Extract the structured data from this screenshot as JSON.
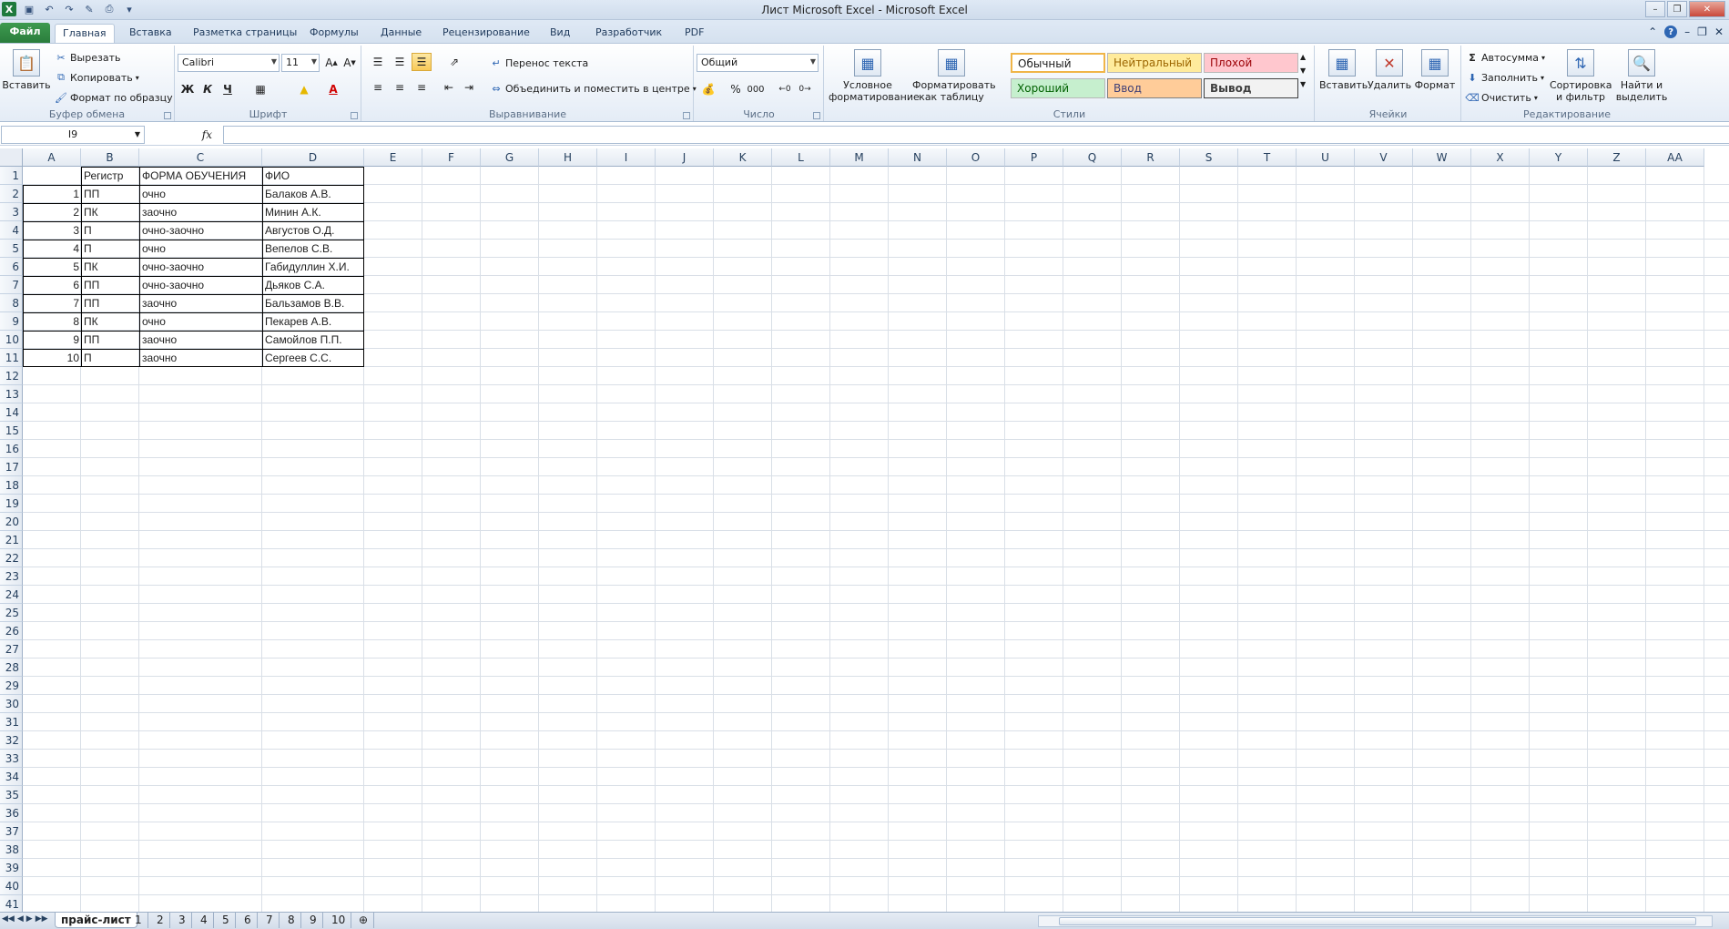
{
  "window": {
    "title": "Лист Microsoft Excel  -  Microsoft Excel"
  },
  "ribbon_tabs": [
    "Файл",
    "Главная",
    "Вставка",
    "Разметка страницы",
    "Формулы",
    "Данные",
    "Рецензирование",
    "Вид",
    "Разработчик",
    "PDF"
  ],
  "clipboard": {
    "paste": "Вставить",
    "cut": "Вырезать",
    "copy": "Копировать",
    "format_painter": "Формат по образцу",
    "label": "Буфер обмена"
  },
  "font": {
    "name": "Calibri",
    "size": "11",
    "bold": "Ж",
    "italic": "К",
    "underline": "Ч",
    "label": "Шрифт"
  },
  "alignment": {
    "wrap_text": "Перенос текста",
    "merge_center": "Объединить и поместить в центре",
    "label": "Выравнивание"
  },
  "number": {
    "format": "Общий",
    "percent": "%",
    "thousands": "000",
    "label": "Число"
  },
  "styles": {
    "conditional": "Условное форматирование",
    "format_table": "Форматировать как таблицу",
    "normal": "Обычный",
    "neutral": "Нейтральный",
    "bad": "Плохой",
    "good": "Хороший",
    "input": "Ввод",
    "output": "Вывод",
    "label": "Стили"
  },
  "cells": {
    "insert": "Вставить",
    "delete": "Удалить",
    "format": "Формат",
    "label": "Ячейки"
  },
  "editing": {
    "autosum": "Автосумма",
    "fill": "Заполнить",
    "clear": "Очистить",
    "sort_filter": "Сортировка и фильтр",
    "find_select": "Найти и выделить",
    "label": "Редактирование"
  },
  "formula_bar": {
    "name_box": "I9",
    "fx": "fx",
    "value": ""
  },
  "columns": [
    "A",
    "B",
    "C",
    "D",
    "E",
    "F",
    "G",
    "H",
    "I",
    "J",
    "K",
    "L",
    "M",
    "N",
    "O",
    "P",
    "Q",
    "R",
    "S",
    "T",
    "U",
    "V",
    "W",
    "X",
    "Y",
    "Z",
    "AA"
  ],
  "row_count": 41,
  "table": {
    "headers": [
      "",
      "Регистр",
      "ФОРМА ОБУЧЕНИЯ",
      "ФИО"
    ],
    "rows": [
      [
        "1",
        "ПП",
        "очно",
        "Балаков А.В."
      ],
      [
        "2",
        "ПК",
        "заочно",
        "Минин А.К."
      ],
      [
        "3",
        "П",
        "очно-заочно",
        "Августов О.Д."
      ],
      [
        "4",
        "П",
        "очно",
        "Вепелов С.В."
      ],
      [
        "5",
        "ПК",
        "очно-заочно",
        "Габидуллин Х.И."
      ],
      [
        "6",
        "ПП",
        "очно-заочно",
        "Дьяков С.А."
      ],
      [
        "7",
        "ПП",
        "заочно",
        "Бальзамов В.В."
      ],
      [
        "8",
        "ПК",
        "очно",
        "Пекарев А.В."
      ],
      [
        "9",
        "ПП",
        "заочно",
        "Самойлов П.П."
      ],
      [
        "10",
        "П",
        "заочно",
        "Сергеев С.С."
      ]
    ]
  },
  "sheets": [
    "прайс-лист",
    "1",
    "2",
    "3",
    "4",
    "5",
    "6",
    "7",
    "8",
    "9",
    "10"
  ],
  "active_sheet": "прайс-лист"
}
